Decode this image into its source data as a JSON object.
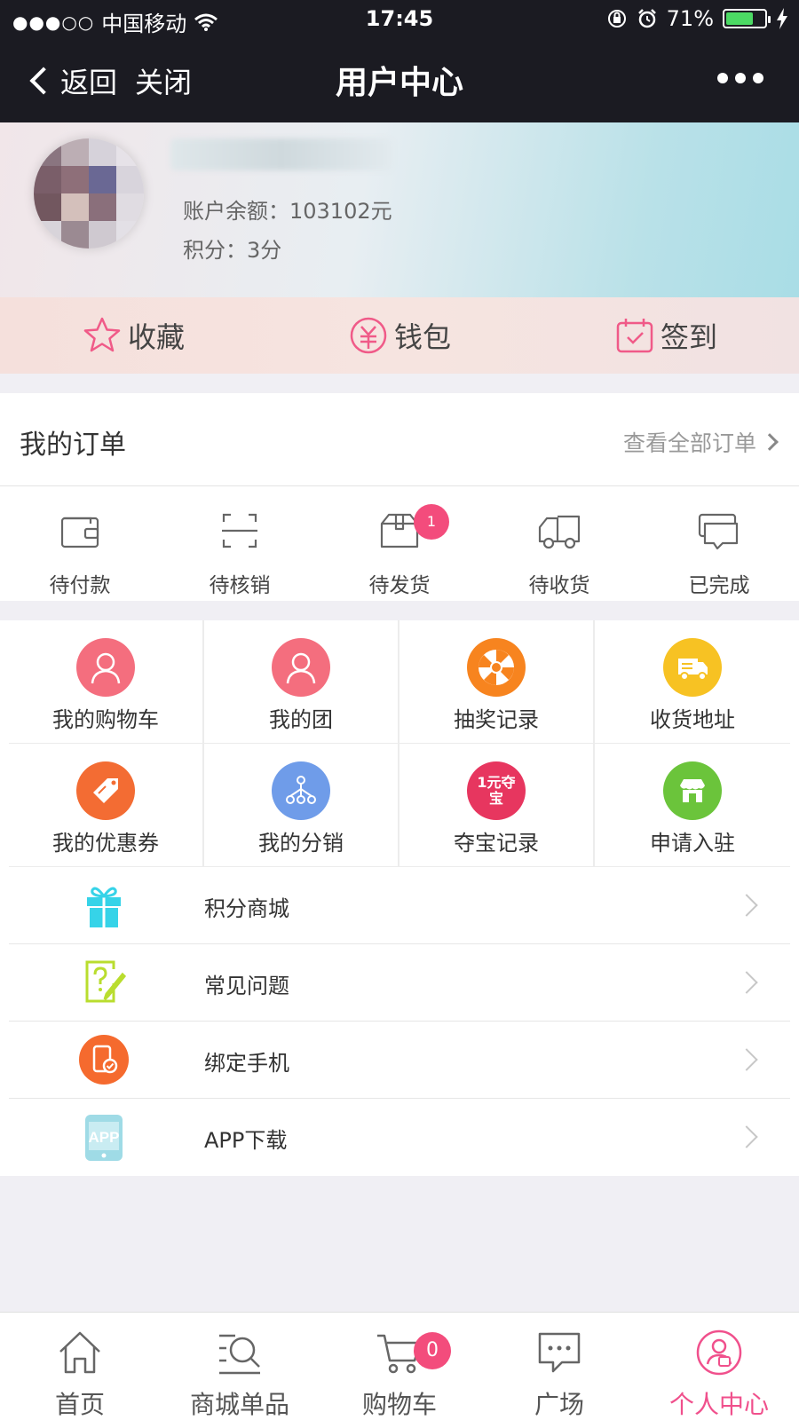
{
  "status_bar": {
    "carrier": "中国移动",
    "signal_dots": "●●●○○",
    "time": "17:45",
    "battery": "71%",
    "battery_level": 0.71
  },
  "nav": {
    "back_label": "返回",
    "close_label": "关闭",
    "title": "用户中心"
  },
  "profile": {
    "balance": "账户余额：103102元",
    "points": "积分：3分"
  },
  "quick_actions": [
    {
      "label": "收藏",
      "icon": "star-icon"
    },
    {
      "label": "钱包",
      "icon": "yen-wallet-icon"
    },
    {
      "label": "签到",
      "icon": "calendar-check-icon"
    }
  ],
  "orders": {
    "title": "我的订单",
    "view_all": "查看全部订单",
    "states": [
      {
        "label": "待付款",
        "icon": "wallet-icon"
      },
      {
        "label": "待核销",
        "icon": "scan-icon"
      },
      {
        "label": "待发货",
        "icon": "package-icon",
        "badge": "1"
      },
      {
        "label": "待收货",
        "icon": "truck-icon"
      },
      {
        "label": "已完成",
        "icon": "chat-bubbles-icon"
      }
    ]
  },
  "grid": [
    {
      "label": "我的购物车",
      "icon": "user-icon",
      "color": "#f46e7e"
    },
    {
      "label": "我的团",
      "icon": "user-icon",
      "color": "#f46e7e"
    },
    {
      "label": "抽奖记录",
      "icon": "lottery-wheel-icon",
      "color": "#f7841f"
    },
    {
      "label": "收货地址",
      "icon": "delivery-truck-icon",
      "color": "#f7c223"
    },
    {
      "label": "我的优惠券",
      "icon": "sale-tag-icon",
      "color": "#f36c33"
    },
    {
      "label": "我的分销",
      "icon": "network-icon",
      "color": "#6f9ce9"
    },
    {
      "label": "夺宝记录",
      "icon": "one-yuan-treasure-icon",
      "color": "#e7365f",
      "icon_text": "1元夺宝"
    },
    {
      "label": "申请入驻",
      "icon": "store-icon",
      "color": "#6bc43b"
    }
  ],
  "list": [
    {
      "label": "积分商城",
      "icon": "gift-icon",
      "color": "#36d3e8"
    },
    {
      "label": "常见问题",
      "icon": "question-note-icon",
      "color": "#b9dd2e"
    },
    {
      "label": "绑定手机",
      "icon": "phone-bind-icon",
      "color": "#f56a2e"
    },
    {
      "label": "APP下载",
      "icon": "app-download-icon",
      "color": "#9fdbe6",
      "icon_text": "APP"
    }
  ],
  "tab_bar": [
    {
      "label": "首页",
      "icon": "home-icon"
    },
    {
      "label": "商城单品",
      "icon": "search-list-icon"
    },
    {
      "label": "购物车",
      "icon": "cart-icon",
      "badge": "0"
    },
    {
      "label": "广场",
      "icon": "chat-icon"
    },
    {
      "label": "个人中心",
      "icon": "profile-icon",
      "active": true
    }
  ],
  "colors": {
    "accent": "#f0508c",
    "nav_bg": "#1b1b22",
    "badge": "#f34c7c"
  }
}
